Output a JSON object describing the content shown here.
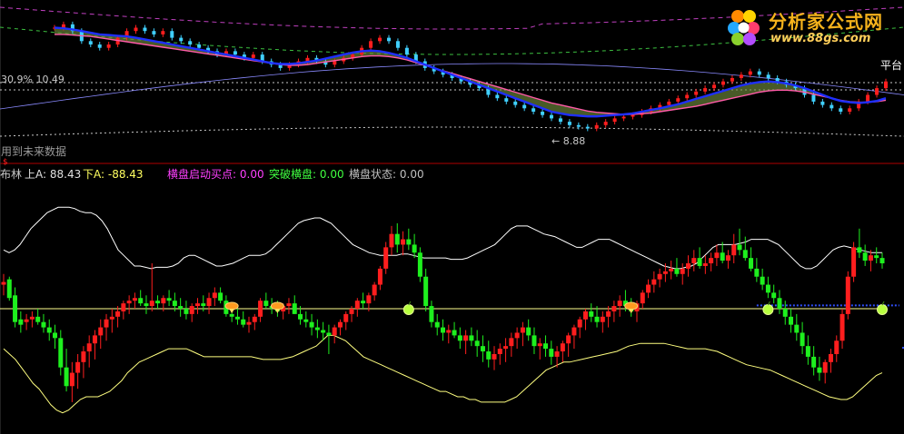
{
  "watermark": {
    "name": "分析家公式网",
    "url": "www.88gs.com"
  },
  "top_panel": {
    "left_label": "30.9% 10.49",
    "right_label": "平台",
    "low_marker": "← 8.88",
    "footer_note": "用到未来数据",
    "dollar_mark": "$"
  },
  "indicator_header": {
    "name": "布林",
    "up": {
      "label": "上A:",
      "value": "88.43"
    },
    "down": {
      "label": "下A:",
      "value": "-88.43"
    },
    "items": [
      {
        "label": "横盘启动买点:",
        "value": "0.00",
        "color": "#ff40ff"
      },
      {
        "label": "突破横盘:",
        "value": "0.00",
        "color": "#40ff40"
      },
      {
        "label": "横盘状态:",
        "value": "0.00",
        "color": "#c0c0c0"
      }
    ]
  },
  "colors": {
    "background": "#000000",
    "up_candle": "#ff1e1e",
    "down_candle": "#1ef01e",
    "band": "#ffffff",
    "lower_band": "#ffff80",
    "mid_line": "#ffff90",
    "ma_blue": "#1e2fff",
    "ma_red": "#e0204c",
    "ma_pink": "#ff5aa8",
    "fill_green": "#6e8a3c",
    "dashed_purple": "#c040c0",
    "dashed_green": "#3cc040",
    "dotted": "#c8c8c8",
    "axis_red": "#b00000"
  },
  "chart_data": {
    "type": "candlestick",
    "title": "布林",
    "ylim": [
      -88.43,
      88.43
    ],
    "mid": 0,
    "candles": [
      [
        18,
        26,
        10,
        20
      ],
      [
        22,
        24,
        6,
        8
      ],
      [
        10,
        16,
        -14,
        -10
      ],
      [
        -8,
        -2,
        -18,
        -12
      ],
      [
        -10,
        -4,
        -16,
        -8
      ],
      [
        -8,
        -2,
        -14,
        -6
      ],
      [
        -6,
        0,
        -12,
        -10
      ],
      [
        -10,
        -4,
        -18,
        -14
      ],
      [
        -14,
        -8,
        -24,
        -18
      ],
      [
        -18,
        -12,
        -30,
        -22
      ],
      [
        -22,
        -16,
        -50,
        -44
      ],
      [
        -44,
        -30,
        -62,
        -58
      ],
      [
        -58,
        -40,
        -70,
        -48
      ],
      [
        -48,
        -34,
        -60,
        -40
      ],
      [
        -40,
        -28,
        -52,
        -32
      ],
      [
        -32,
        -20,
        -44,
        -26
      ],
      [
        -26,
        -16,
        -38,
        -20
      ],
      [
        -20,
        -8,
        -30,
        -14
      ],
      [
        -14,
        -4,
        -24,
        -8
      ],
      [
        -8,
        0,
        -18,
        -6
      ],
      [
        -6,
        2,
        -14,
        -2
      ],
      [
        -2,
        6,
        -8,
        4
      ],
      [
        4,
        10,
        -4,
        6
      ],
      [
        6,
        12,
        0,
        8
      ],
      [
        8,
        14,
        2,
        4
      ],
      [
        4,
        10,
        -4,
        2
      ],
      [
        2,
        34,
        -2,
        6
      ],
      [
        6,
        10,
        0,
        4
      ],
      [
        4,
        10,
        -2,
        8
      ],
      [
        8,
        14,
        2,
        6
      ],
      [
        6,
        12,
        -2,
        2
      ],
      [
        2,
        8,
        -6,
        0
      ],
      [
        0,
        6,
        -8,
        -4
      ],
      [
        -4,
        4,
        -10,
        2
      ],
      [
        2,
        8,
        -4,
        4
      ],
      [
        4,
        10,
        -2,
        2
      ],
      [
        2,
        12,
        -4,
        8
      ],
      [
        8,
        16,
        2,
        12
      ],
      [
        12,
        16,
        4,
        6
      ],
      [
        6,
        10,
        -6,
        -4
      ],
      [
        -4,
        2,
        -10,
        -6
      ],
      [
        -6,
        0,
        -12,
        -8
      ],
      [
        -8,
        -2,
        -14,
        -12
      ],
      [
        -12,
        -6,
        -18,
        -10
      ],
      [
        -10,
        -4,
        -16,
        -6
      ],
      [
        -6,
        8,
        -10,
        6
      ],
      [
        6,
        12,
        0,
        2
      ],
      [
        2,
        8,
        -4,
        0
      ],
      [
        0,
        6,
        -6,
        -2
      ],
      [
        -2,
        4,
        -8,
        2
      ],
      [
        2,
        8,
        -4,
        4
      ],
      [
        4,
        10,
        -4,
        -4
      ],
      [
        -4,
        2,
        -12,
        -8
      ],
      [
        -8,
        -2,
        -14,
        -10
      ],
      [
        -10,
        -4,
        -20,
        -14
      ],
      [
        -14,
        -8,
        -22,
        -16
      ],
      [
        -16,
        -10,
        -24,
        -18
      ],
      [
        -18,
        -12,
        -34,
        -20
      ],
      [
        -20,
        -12,
        -26,
        -14
      ],
      [
        -14,
        -8,
        -20,
        -10
      ],
      [
        -10,
        -2,
        -16,
        -4
      ],
      [
        -4,
        2,
        -10,
        0
      ],
      [
        0,
        8,
        -6,
        6
      ],
      [
        6,
        12,
        0,
        4
      ],
      [
        4,
        12,
        -2,
        10
      ],
      [
        10,
        20,
        6,
        18
      ],
      [
        18,
        32,
        14,
        30
      ],
      [
        30,
        50,
        26,
        46
      ],
      [
        46,
        62,
        40,
        56
      ],
      [
        56,
        64,
        42,
        48
      ],
      [
        48,
        58,
        40,
        52
      ],
      [
        52,
        60,
        44,
        48
      ],
      [
        48,
        56,
        38,
        42
      ],
      [
        42,
        46,
        20,
        24
      ],
      [
        24,
        30,
        -2,
        2
      ],
      [
        2,
        6,
        -14,
        -10
      ],
      [
        -10,
        -4,
        -20,
        -14
      ],
      [
        -14,
        -8,
        -24,
        -18
      ],
      [
        -18,
        -12,
        -26,
        -16
      ],
      [
        -16,
        -10,
        -22,
        -20
      ],
      [
        -20,
        -14,
        -30,
        -24
      ],
      [
        -24,
        -16,
        -34,
        -20
      ],
      [
        -20,
        -14,
        -28,
        -24
      ],
      [
        -24,
        -16,
        -36,
        -28
      ],
      [
        -28,
        -20,
        -40,
        -32
      ],
      [
        -32,
        -24,
        -44,
        -38
      ],
      [
        -38,
        -28,
        -46,
        -34
      ],
      [
        -34,
        -26,
        -42,
        -30
      ],
      [
        -30,
        -22,
        -40,
        -28
      ],
      [
        -28,
        -18,
        -36,
        -22
      ],
      [
        -22,
        -14,
        -30,
        -18
      ],
      [
        -18,
        -10,
        -28,
        -14
      ],
      [
        -14,
        -8,
        -24,
        -20
      ],
      [
        -20,
        -14,
        -34,
        -28
      ],
      [
        -28,
        -22,
        -38,
        -26
      ],
      [
        -26,
        -20,
        -36,
        -30
      ],
      [
        -30,
        -24,
        -42,
        -36
      ],
      [
        -36,
        -28,
        -44,
        -32
      ],
      [
        -32,
        -24,
        -40,
        -26
      ],
      [
        -26,
        -18,
        -36,
        -20
      ],
      [
        -20,
        -12,
        -30,
        -14
      ],
      [
        -14,
        -6,
        -22,
        -8
      ],
      [
        -8,
        0,
        -16,
        -2
      ],
      [
        -2,
        4,
        -10,
        -6
      ],
      [
        -6,
        2,
        -14,
        -10
      ],
      [
        -10,
        -2,
        -18,
        -6
      ],
      [
        -6,
        2,
        -14,
        -2
      ],
      [
        -2,
        6,
        -10,
        2
      ],
      [
        2,
        10,
        -6,
        6
      ],
      [
        6,
        14,
        -2,
        2
      ],
      [
        2,
        8,
        -6,
        -2
      ],
      [
        -2,
        6,
        -10,
        4
      ],
      [
        4,
        14,
        0,
        12
      ],
      [
        12,
        22,
        8,
        18
      ],
      [
        18,
        28,
        12,
        22
      ],
      [
        22,
        30,
        16,
        26
      ],
      [
        26,
        34,
        20,
        28
      ],
      [
        28,
        36,
        22,
        30
      ],
      [
        30,
        38,
        24,
        26
      ],
      [
        26,
        34,
        18,
        30
      ],
      [
        30,
        40,
        24,
        34
      ],
      [
        34,
        44,
        28,
        38
      ],
      [
        38,
        46,
        30,
        32
      ],
      [
        32,
        40,
        26,
        34
      ],
      [
        34,
        42,
        28,
        38
      ],
      [
        38,
        48,
        32,
        42
      ],
      [
        42,
        50,
        34,
        36
      ],
      [
        36,
        44,
        30,
        40
      ],
      [
        40,
        56,
        34,
        48
      ],
      [
        48,
        60,
        40,
        44
      ],
      [
        44,
        54,
        36,
        38
      ],
      [
        38,
        46,
        28,
        30
      ],
      [
        30,
        38,
        20,
        24
      ],
      [
        24,
        30,
        14,
        18
      ],
      [
        18,
        24,
        8,
        12
      ],
      [
        12,
        18,
        4,
        8
      ],
      [
        8,
        14,
        -4,
        0
      ],
      [
        0,
        6,
        -12,
        -6
      ],
      [
        -6,
        0,
        -18,
        -12
      ],
      [
        -12,
        -4,
        -24,
        -18
      ],
      [
        -18,
        -10,
        -34,
        -28
      ],
      [
        -28,
        -20,
        -42,
        -36
      ],
      [
        -36,
        -28,
        -50,
        -44
      ],
      [
        -44,
        -36,
        -54,
        -48
      ],
      [
        -48,
        -38,
        -56,
        -40
      ],
      [
        -40,
        -30,
        -48,
        -34
      ],
      [
        -34,
        -20,
        -40,
        -24
      ],
      [
        -24,
        0,
        -30,
        -4
      ],
      [
        -4,
        28,
        -8,
        24
      ],
      [
        24,
        50,
        20,
        46
      ],
      [
        46,
        60,
        38,
        42
      ],
      [
        42,
        48,
        32,
        36
      ],
      [
        36,
        44,
        28,
        40
      ],
      [
        40,
        46,
        34,
        38
      ],
      [
        38,
        42,
        30,
        34
      ]
    ],
    "upper_band": [
      44,
      42,
      44,
      48,
      54,
      60,
      64,
      68,
      72,
      74,
      76,
      76,
      76,
      75,
      73,
      72,
      72,
      70,
      66,
      60,
      52,
      44,
      40,
      36,
      32,
      32,
      31,
      30,
      31,
      31,
      31,
      32,
      34,
      38,
      40,
      40,
      38,
      36,
      34,
      32,
      32,
      33,
      34,
      36,
      38,
      40,
      40,
      40,
      41,
      44,
      48,
      52,
      56,
      60,
      64,
      66,
      67,
      68,
      68,
      66,
      64,
      60,
      56,
      52,
      48,
      46,
      44,
      42,
      41,
      40,
      40,
      40,
      40,
      41,
      41,
      40,
      39,
      38,
      38,
      38,
      38,
      38,
      37,
      37,
      37,
      38,
      40,
      42,
      44,
      46,
      48,
      52,
      56,
      60,
      62,
      62,
      62,
      60,
      58,
      56,
      55,
      54,
      52,
      50,
      48,
      46,
      46,
      48,
      50,
      52,
      52,
      52,
      50,
      48,
      46,
      44,
      42,
      40,
      38,
      36,
      34,
      32,
      31,
      30,
      30,
      31,
      32,
      34,
      38,
      42,
      46,
      48,
      48,
      48,
      48,
      49,
      50,
      52,
      52,
      52,
      52,
      50,
      48,
      44,
      40,
      36,
      32,
      30,
      30,
      32,
      36,
      40,
      44,
      46,
      47,
      46,
      45,
      44,
      43,
      42,
      42,
      42
    ],
    "lower_band": [
      -30,
      -34,
      -38,
      -44,
      -50,
      -56,
      -60,
      -66,
      -72,
      -76,
      -78,
      -76,
      -72,
      -68,
      -66,
      -66,
      -66,
      -64,
      -62,
      -58,
      -54,
      -48,
      -44,
      -40,
      -38,
      -36,
      -34,
      -32,
      -30,
      -30,
      -30,
      -30,
      -32,
      -34,
      -36,
      -36,
      -36,
      -36,
      -36,
      -36,
      -36,
      -36,
      -36,
      -37,
      -38,
      -38,
      -38,
      -38,
      -37,
      -36,
      -34,
      -32,
      -30,
      -28,
      -24,
      -20,
      -20,
      -22,
      -24,
      -28,
      -32,
      -36,
      -38,
      -40,
      -42,
      -44,
      -46,
      -48,
      -50,
      -52,
      -54,
      -56,
      -58,
      -60,
      -62,
      -62,
      -64,
      -66,
      -66,
      -68,
      -68,
      -70,
      -70,
      -70,
      -70,
      -70,
      -68,
      -66,
      -62,
      -58,
      -54,
      -50,
      -46,
      -44,
      -42,
      -40,
      -40,
      -39,
      -38,
      -37,
      -36,
      -35,
      -34,
      -33,
      -32,
      -30,
      -28,
      -27,
      -26,
      -26,
      -26,
      -26,
      -26,
      -27,
      -28,
      -29,
      -30,
      -30,
      -30,
      -30,
      -31,
      -32,
      -34,
      -36,
      -38,
      -40,
      -42,
      -43,
      -44,
      -45,
      -46,
      -48,
      -50,
      -52,
      -54,
      -56,
      -58,
      -60,
      -62,
      -64,
      -66,
      -67,
      -68,
      -68,
      -66,
      -62,
      -58,
      -54,
      -50,
      -48
    ],
    "signals": [
      {
        "type": "buy-flag",
        "index": 40,
        "y": 0
      },
      {
        "type": "buy-flag",
        "index": 48,
        "y": 0
      },
      {
        "type": "apple",
        "index": 71,
        "y": 0
      },
      {
        "type": "buy-flag",
        "index": 110,
        "y": 0
      },
      {
        "type": "apple",
        "index": 134,
        "y": 0
      },
      {
        "type": "apple",
        "index": 154,
        "y": 0
      }
    ]
  },
  "price_chart": {
    "type": "candlestick",
    "ylim": [
      8.5,
      12.5
    ],
    "closes": [
      12.0,
      12.1,
      11.9,
      11.6,
      11.5,
      11.4,
      11.5,
      11.7,
      11.9,
      12.0,
      11.9,
      11.8,
      11.9,
      11.7,
      11.6,
      11.5,
      11.4,
      11.3,
      11.2,
      11.3,
      11.2,
      11.1,
      11.2,
      11.0,
      10.9,
      10.8,
      10.9,
      11.0,
      11.1,
      11.0,
      10.9,
      11.0,
      11.1,
      11.2,
      11.4,
      11.6,
      11.7,
      11.6,
      11.4,
      11.2,
      11.0,
      10.8,
      10.7,
      10.6,
      10.5,
      10.4,
      10.3,
      10.2,
      10.0,
      9.9,
      9.8,
      9.7,
      9.6,
      9.5,
      9.4,
      9.3,
      9.2,
      9.1,
      9.05,
      9.0,
      9.1,
      9.2,
      9.3,
      9.35,
      9.4,
      9.5,
      9.6,
      9.7,
      9.8,
      9.9,
      10.0,
      10.1,
      10.2,
      10.3,
      10.4,
      10.5,
      10.6,
      10.7,
      10.6,
      10.5,
      10.4,
      10.3,
      10.2,
      10.0,
      9.8,
      9.7,
      9.6,
      9.5,
      9.6,
      9.8,
      10.0,
      10.2,
      10.4
    ],
    "ma_blue": [
      12.0,
      11.98,
      11.95,
      11.9,
      11.85,
      11.8,
      11.78,
      11.76,
      11.74,
      11.7,
      11.65,
      11.6,
      11.55,
      11.5,
      11.45,
      11.4,
      11.35,
      11.3,
      11.25,
      11.2,
      11.15,
      11.1,
      11.05,
      11.0,
      10.95,
      10.92,
      10.92,
      10.94,
      10.98,
      11.02,
      11.08,
      11.14,
      11.2,
      11.26,
      11.3,
      11.32,
      11.3,
      11.25,
      11.18,
      11.1,
      11.0,
      10.9,
      10.8,
      10.7,
      10.6,
      10.5,
      10.4,
      10.3,
      10.2,
      10.1,
      10.0,
      9.9,
      9.8,
      9.7,
      9.6,
      9.5,
      9.45,
      9.4,
      9.38,
      9.36,
      9.36,
      9.38,
      9.4,
      9.42,
      9.45,
      9.5,
      9.55,
      9.6,
      9.66,
      9.72,
      9.8,
      9.88,
      9.96,
      10.04,
      10.12,
      10.2,
      10.28,
      10.34,
      10.38,
      10.4,
      10.38,
      10.34,
      10.28,
      10.2,
      10.1,
      10.0,
      9.9,
      9.82,
      9.78,
      9.76,
      9.78,
      9.82,
      9.9
    ],
    "ma_red": [
      11.8,
      11.8,
      11.78,
      11.76,
      11.74,
      11.7,
      11.66,
      11.62,
      11.58,
      11.54,
      11.5,
      11.46,
      11.42,
      11.38,
      11.34,
      11.3,
      11.26,
      11.22,
      11.18,
      11.14,
      11.1,
      11.06,
      11.02,
      10.98,
      10.94,
      10.9,
      10.88,
      10.88,
      10.9,
      10.94,
      10.98,
      11.02,
      11.06,
      11.1,
      11.14,
      11.16,
      11.16,
      11.14,
      11.1,
      11.04,
      10.96,
      10.88,
      10.8,
      10.72,
      10.64,
      10.56,
      10.48,
      10.4,
      10.32,
      10.24,
      10.16,
      10.08,
      10.0,
      9.92,
      9.84,
      9.76,
      9.7,
      9.64,
      9.58,
      9.52,
      9.48,
      9.46,
      9.44,
      9.42,
      9.42,
      9.44,
      9.46,
      9.5,
      9.54,
      9.58,
      9.62,
      9.66,
      9.72,
      9.78,
      9.84,
      9.9,
      9.96,
      10.02,
      10.08,
      10.12,
      10.14,
      10.14,
      10.12,
      10.08,
      10.02,
      9.96,
      9.9,
      9.84,
      9.8,
      9.78,
      9.78,
      9.8,
      9.84
    ]
  }
}
